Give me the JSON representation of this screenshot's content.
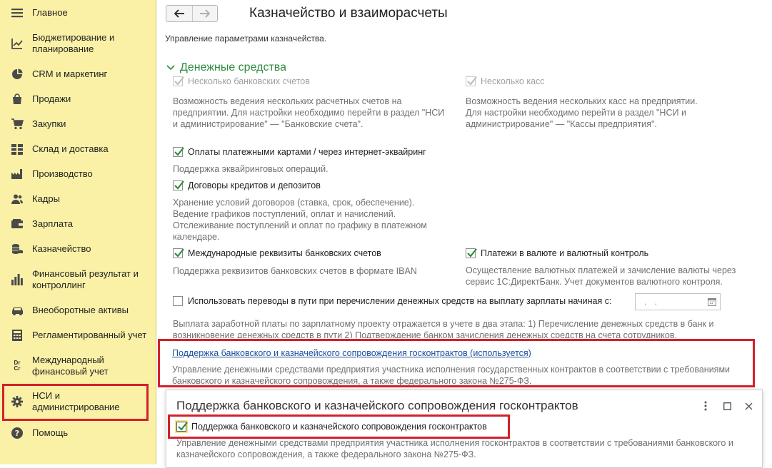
{
  "sidebar": {
    "items": [
      {
        "icon": "menu-icon",
        "label": "Главное"
      },
      {
        "icon": "chart-trend-icon",
        "label": "Бюджетирование и\nпланирование"
      },
      {
        "icon": "pie-chart-icon",
        "label": "CRM и маркетинг"
      },
      {
        "icon": "shopping-bag-icon",
        "label": "Продажи"
      },
      {
        "icon": "cart-icon",
        "label": "Закупки"
      },
      {
        "icon": "warehouse-grid-icon",
        "label": "Склад и доставка"
      },
      {
        "icon": "factory-icon",
        "label": "Производство"
      },
      {
        "icon": "people-icon",
        "label": "Кадры"
      },
      {
        "icon": "wallet-icon",
        "label": "Зарплата"
      },
      {
        "icon": "coins-icon",
        "label": "Казначейство"
      },
      {
        "icon": "bar-chart-icon",
        "label": "Финансовый результат и\nконтроллинг"
      },
      {
        "icon": "car-icon",
        "label": "Внеоборотные активы"
      },
      {
        "icon": "document-calc-icon",
        "label": "Регламентированный учет"
      },
      {
        "icon": "dr-cr-icon",
        "label": "Международный\nфинансовый учет",
        "glyph": "Dr\nCr"
      },
      {
        "icon": "gear-icon",
        "label": "НСИ и\nадминистрирование"
      },
      {
        "icon": "help-icon",
        "label": "Помощь"
      }
    ]
  },
  "header": {
    "title": "Казначейство и взаиморасчеты",
    "subtitle": "Управление параметрами казначейства."
  },
  "section": {
    "title": "Денежные средства"
  },
  "options": {
    "multi_accounts": {
      "label": "Несколько банковских счетов",
      "checked": true,
      "disabled": true,
      "desc": "Возможность ведения нескольких расчетных счетов на\nпредприятии. Для настройки необходимо перейти в раздел \"НСИ\nи администрирование\" — \"Банковские счета\"."
    },
    "multi_cash": {
      "label": "Несколько касс",
      "checked": true,
      "disabled": true,
      "desc": "Возможность ведения нескольких касс на предприятии.\nДля настройки необходимо перейти в раздел \"НСИ и\nадминистрирование\" — \"Кассы предприятия\"."
    },
    "card_payments": {
      "label": "Оплаты платежными картами / через интернет-эквайринг",
      "checked": true,
      "desc": "Поддержка эквайринговых операций."
    },
    "loans": {
      "label": "Договоры кредитов и депозитов",
      "checked": true,
      "desc": "Хранение условий договоров (ставка, срок, обеспечение).\nВедение графиков поступлений, оплат и начислений.\nОтслеживание поступлений и оплат по графику в платежном\nкалендаре."
    },
    "intl_requisites": {
      "label": "Международные реквизиты банковских счетов",
      "checked": true,
      "desc": "Поддержка реквизитов банковских счетов в формате IBAN"
    },
    "currency": {
      "label": "Платежи в валюте и валютный контроль",
      "checked": true,
      "desc": "Осуществление валютных платежей и зачисление валюты через\nсервис 1С:ДиректБанк. Учет документов валютного контроля."
    },
    "transit": {
      "label": "Использовать переводы в пути при перечислении денежных средств на выплату зарплаты начиная с:",
      "checked": false,
      "date_placeholder": ". .",
      "desc": "Выплата заработной платы по зарплатному проекту отражается в учете в два этапа: 1) Перечисление денежных средств в банк и\nвозникновение денежных средств в пути 2) Подтверждение банком зачисления денежных средств на счета сотрудников."
    }
  },
  "gov_contracts": {
    "link": "Поддержка банковского и казначейского сопровождения госконтрактов (используется)",
    "desc": "Управление денежными средствами предприятия участника исполнения государственных контрактов в соответствии с требованиями\nбанковского и казначейского сопровождения, а также федерального закона №275-ФЗ."
  },
  "popup": {
    "title": "Поддержка банковского и казначейского сопровождения госконтрактов",
    "checkbox_label": "Поддержка банковского и казначейского сопровождения госконтрактов",
    "checked": true,
    "desc": "Управление денежными средствами предприятия участника исполнения госконтрактов в соответствии с требованиями банковского и\nказначейского сопровождения, а также федерального закона №275-ФЗ."
  },
  "colors": {
    "sidebar_bg": "#fbf1a6",
    "accent_green": "#2e8b3c",
    "highlight": "#d4202a",
    "link": "#1a4f9c"
  }
}
